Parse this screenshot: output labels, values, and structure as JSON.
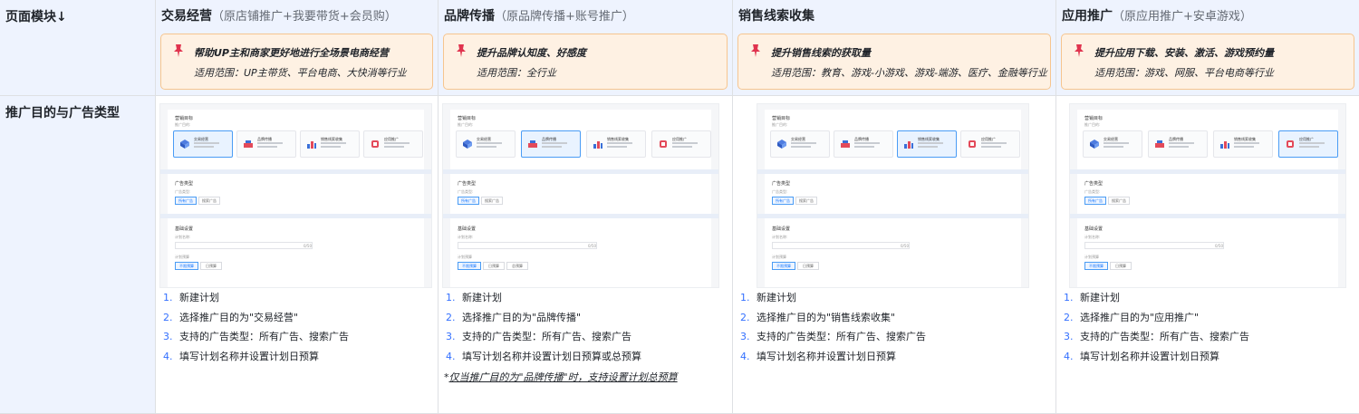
{
  "header": {
    "corner": "页面模块↓",
    "row_label": "推广目的与广告类型"
  },
  "columns": [
    {
      "title": "交易经营",
      "subtitle": "（原店铺推广+我要带货+会员购）",
      "callout_title": "帮助UP主和商家更好地进行全场景电商经营",
      "callout_scope": "适用范围：UP主带货、平台电商、大快消等行业",
      "steps": [
        "新建计划",
        "选择推广目的为\"交易经营\"",
        "支持的广告类型：所有广告、搜索广告",
        "填写计划名称并设置计划日预算"
      ],
      "note": ""
    },
    {
      "title": "品牌传播",
      "subtitle": "（原品牌传播+账号推广）",
      "callout_title": "提升品牌认知度、好感度",
      "callout_scope": "适用范围：全行业",
      "steps": [
        "新建计划",
        "选择推广目的为\"品牌传播\"",
        "支持的广告类型：所有广告、搜索广告",
        "填写计划名称并设置计划日预算或总预算"
      ],
      "note_prefix": "*",
      "note": "仅当推广目的为\"品牌传播\"时，支持设置计划总预算"
    },
    {
      "title": "销售线索收集",
      "subtitle": "",
      "callout_title": "提升销售线索的获取量",
      "callout_scope": "适用范围：教育、游戏-小游戏、游戏-端游、医疗、金融等行业",
      "steps": [
        "新建计划",
        "选择推广目的为\"销售线索收集\"",
        "支持的广告类型：所有广告、搜索广告",
        "填写计划名称并设置计划日预算"
      ],
      "note": ""
    },
    {
      "title": "应用推广",
      "subtitle": "（原应用推广+安卓游戏）",
      "callout_title": "提升应用下载、安装、激活、游戏预约量",
      "callout_scope": "适用范围：游戏、网服、平台电商等行业",
      "steps": [
        "新建计划",
        "选择推广目的为\"应用推广\"",
        "支持的广告类型：所有广告、搜索广告",
        "填写计划名称并设置计划日预算"
      ],
      "note": ""
    }
  ],
  "step_numbers": [
    "1.",
    "2.",
    "3.",
    "4."
  ],
  "mini_ui": {
    "section1": "营销目标",
    "label1": "推广目的:",
    "options": [
      "交易经营",
      "品牌传播",
      "销售线索收集",
      "应用推广"
    ],
    "section2": "广告类型",
    "label2": "广告类型:",
    "ad_types": [
      "所有广告",
      "搜索广告"
    ],
    "section3": "基础设置",
    "label3": "计划名称:",
    "input_ph": "请输入计划名称",
    "counter": "0/50",
    "label4": "计划预算",
    "budget": [
      "不限预算",
      "日预算",
      "总预算"
    ]
  },
  "colors": {
    "header_bg": "#eef3fe",
    "callout_bg": "#fef1e3",
    "callout_border": "#f6c58f",
    "step_number": "#3370ff",
    "selected": "#4a9cf5"
  }
}
